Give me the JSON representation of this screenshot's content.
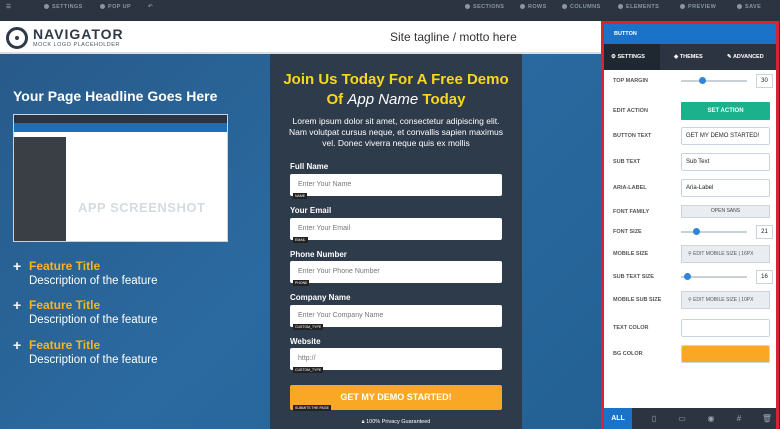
{
  "topbar": {
    "settings": "SETTINGS",
    "popup": "POP UP",
    "sections": "SECTIONS",
    "rows": "ROWS",
    "columns": "COLUMNS",
    "elements": "ELEMENTS",
    "preview": "PREVIEW",
    "save": "SAVE"
  },
  "header": {
    "logo_title": "NAVIGATOR",
    "logo_sub": "MOCK LOGO PLACEHOLDER",
    "tagline": "Site tagline / motto here"
  },
  "hero": {
    "headline": "Your Page Headline Goes Here",
    "screenshot_label": "APP SCREENSHOT",
    "features": [
      {
        "title": "Feature Title",
        "desc": "Description of the feature"
      },
      {
        "title": "Feature Title",
        "desc": "Description of the feature"
      },
      {
        "title": "Feature Title",
        "desc": "Description of the feature"
      }
    ]
  },
  "form": {
    "heading_a": "Join Us Today For A Free Demo Of ",
    "heading_i": "App Name",
    "heading_b": " Today",
    "paragraph": "Lorem ipsum dolor sit amet, consectetur adipiscing elit. Nam volutpat cursus neque, et convallis sapien maximus vel. Donec viverra neque quis ex mollis",
    "fields": [
      {
        "label": "Full Name",
        "placeholder": "Enter Your Name",
        "tag": "NAME"
      },
      {
        "label": "Your Email",
        "placeholder": "Enter Your Email",
        "tag": "EMAIL"
      },
      {
        "label": "Phone Number",
        "placeholder": "Enter Your Phone Number",
        "tag": "PHONE"
      },
      {
        "label": "Company Name",
        "placeholder": "Enter Your Company Name",
        "tag": "CUSTOM_TYPE"
      },
      {
        "label": "Website",
        "placeholder": "http://",
        "tag": "CUSTOM_TYPE"
      }
    ],
    "cta": "GET MY DEMO STARTED!",
    "cta_tag": "SUBMITS THE PAGE",
    "privacy": "100% Privacy Guaranteed"
  },
  "panel": {
    "title": "BUTTON",
    "tabs": {
      "settings": "SETTINGS",
      "themes": "THEMES",
      "advanced": "ADVANCED"
    },
    "top_margin_label": "TOP MARGIN",
    "top_margin": "30",
    "top_margin_level": 0.3,
    "edit_action_label": "EDIT ACTION",
    "edit_action_btn": "SET ACTION",
    "button_text_label": "BUTTON TEXT",
    "button_text": "GET MY DEMO STARTED!",
    "sub_text_label": "SUB TEXT",
    "sub_text": "Sub Text",
    "aria_label_label": "ARIA-LABEL",
    "aria_label": "Aria-Label",
    "font_family_label": "FONT FAMILY",
    "font_family": "OPEN SANS",
    "font_size_label": "FONT SIZE",
    "font_size": "21",
    "font_size_level": 0.2,
    "mobile_size_label": "MOBILE SIZE",
    "mobile_size": "EDIT MOBILE SIZE",
    "mobile_size_val": "16PX",
    "sub_text_size_label": "SUB TEXT SIZE",
    "sub_text_size": "16",
    "sub_text_size_level": 0.05,
    "mobile_sub_size_label": "MOBILE SUB SIZE",
    "mobile_sub_size": "EDIT MOBILE SIZE",
    "mobile_sub_size_val": "10PX",
    "text_color_label": "TEXT COLOR",
    "text_color": "#ffffff",
    "bg_color_label": "BG COLOR",
    "bg_color": "#f9a825",
    "footer_all": "ALL"
  }
}
